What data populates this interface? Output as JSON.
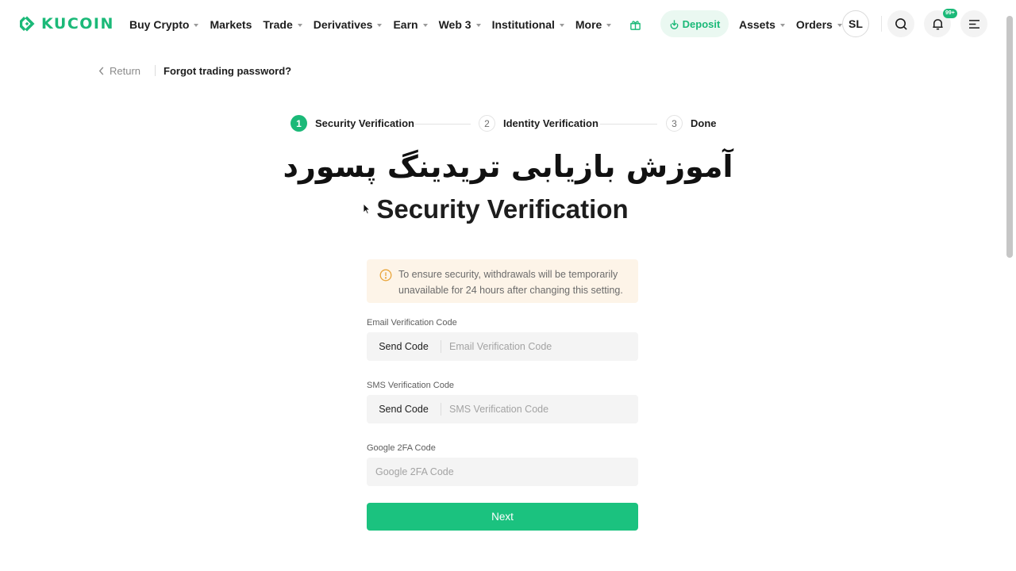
{
  "header": {
    "brand": "KUCOIN",
    "brand_color": "#1bb978",
    "nav": [
      {
        "label": "Buy Crypto",
        "dropdown": true
      },
      {
        "label": "Markets",
        "dropdown": false
      },
      {
        "label": "Trade",
        "dropdown": true
      },
      {
        "label": "Derivatives",
        "dropdown": true
      },
      {
        "label": "Earn",
        "dropdown": true
      },
      {
        "label": "Web 3",
        "dropdown": true
      },
      {
        "label": "Institutional",
        "dropdown": true
      },
      {
        "label": "More",
        "dropdown": true
      }
    ],
    "deposit_label": "Deposit",
    "assets_label": "Assets",
    "orders_label": "Orders",
    "avatar_initials": "SL",
    "notification_badge": "99+",
    "icons": [
      "gift-icon",
      "deposit-icon",
      "search-icon",
      "bell-icon",
      "menu-icon"
    ]
  },
  "breadcrumb": {
    "return_label": "Return",
    "title": "Forgot trading password?"
  },
  "stepper": {
    "steps": [
      {
        "number": "1",
        "label": "Security Verification",
        "active": true
      },
      {
        "number": "2",
        "label": "Identity Verification",
        "active": false
      },
      {
        "number": "3",
        "label": "Done",
        "active": false
      }
    ]
  },
  "overlay_title": "آموزش بازیابی تریدینگ پسورد",
  "page_title": "Security Verification",
  "notice": {
    "text": "To ensure security, withdrawals will be temporarily unavailable for 24 hours after changing this setting.",
    "color": "#fdf4e8"
  },
  "form": {
    "email": {
      "label": "Email Verification Code",
      "send_label": "Send Code",
      "placeholder": "Email Verification Code",
      "value": ""
    },
    "sms": {
      "label": "SMS Verification Code",
      "send_label": "Send Code",
      "placeholder": "SMS Verification Code",
      "value": ""
    },
    "google": {
      "label": "Google 2FA Code",
      "placeholder": "Google 2FA Code",
      "value": ""
    },
    "next_label": "Next",
    "accent_color": "#1bc27f"
  }
}
